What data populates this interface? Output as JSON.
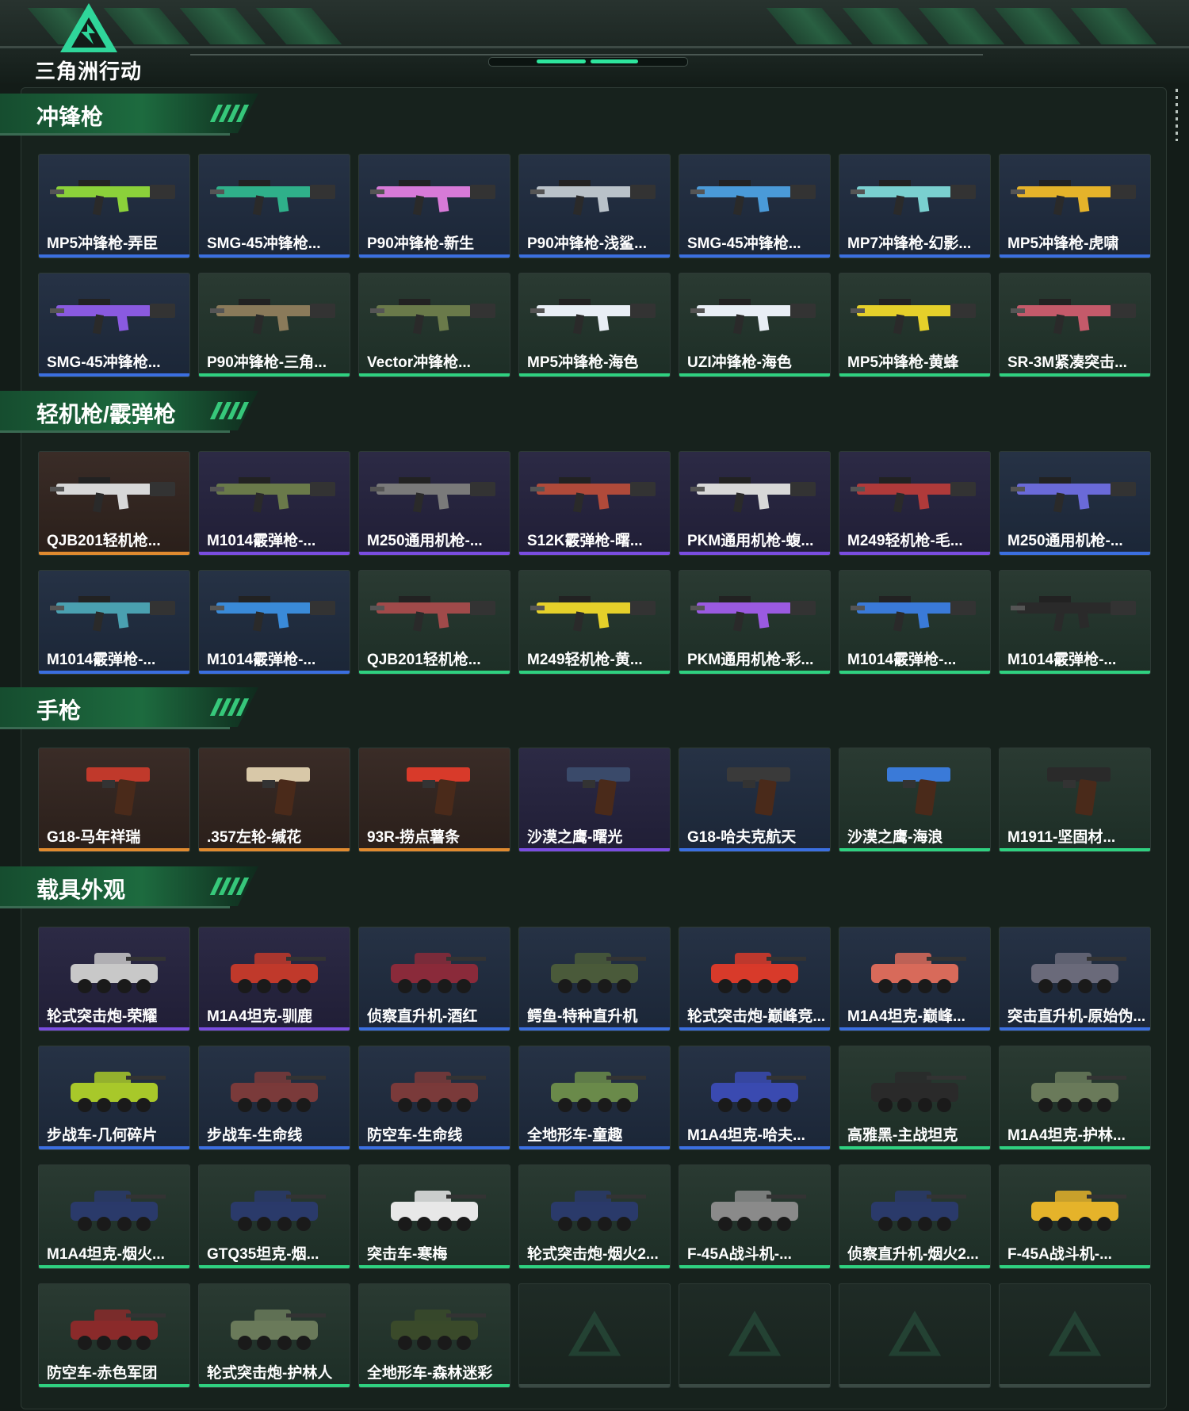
{
  "brand": {
    "name": "三角洲行动"
  },
  "colors": {
    "green": "#2fd180",
    "blue": "#3b6fe0",
    "purple": "#7a4de0",
    "orange": "#e08a2f",
    "empty": "#3a4a44"
  },
  "sections": [
    {
      "title": "冲锋枪",
      "kind": "gun",
      "items": [
        {
          "label": "MP5冲锋枪-弄臣",
          "rarity": "blue",
          "color": "#8bd13a"
        },
        {
          "label": "SMG-45冲锋枪...",
          "rarity": "blue",
          "color": "#2fb08a"
        },
        {
          "label": "P90冲锋枪-新生",
          "rarity": "blue",
          "color": "#d77ad8"
        },
        {
          "label": "P90冲锋枪-浅鲨...",
          "rarity": "blue",
          "color": "#b9c2c9"
        },
        {
          "label": "SMG-45冲锋枪...",
          "rarity": "blue",
          "color": "#4a9ad8"
        },
        {
          "label": "MP7冲锋枪-幻影...",
          "rarity": "blue",
          "color": "#7ad0d0"
        },
        {
          "label": "MP5冲锋枪-虎啸",
          "rarity": "blue",
          "color": "#e5b32a"
        },
        {
          "label": "SMG-45冲锋枪...",
          "rarity": "blue",
          "color": "#8a5ae0"
        },
        {
          "label": "P90冲锋枪-三角...",
          "rarity": "green",
          "color": "#8a7a5a"
        },
        {
          "label": "Vector冲锋枪...",
          "rarity": "green",
          "color": "#6a7a4a"
        },
        {
          "label": "MP5冲锋枪-海色",
          "rarity": "green",
          "color": "#e8eef5"
        },
        {
          "label": "UZI冲锋枪-海色",
          "rarity": "green",
          "color": "#e8eef5"
        },
        {
          "label": "MP5冲锋枪-黄蜂",
          "rarity": "green",
          "color": "#e5d02a"
        },
        {
          "label": "SR-3M紧凑突击...",
          "rarity": "green",
          "color": "#c45a6a"
        }
      ]
    },
    {
      "title": "轻机枪/霰弹枪",
      "kind": "gun",
      "items": [
        {
          "label": "QJB201轻机枪...",
          "rarity": "orange",
          "color": "#d8d8d8"
        },
        {
          "label": "M1014霰弹枪-...",
          "rarity": "purple",
          "color": "#6a7a4a"
        },
        {
          "label": "M250通用机枪-...",
          "rarity": "purple",
          "color": "#7a7a7a"
        },
        {
          "label": "S12K霰弹枪-曙...",
          "rarity": "purple",
          "color": "#b04a3a"
        },
        {
          "label": "PKM通用机枪-蝮...",
          "rarity": "purple",
          "color": "#d8d8d8"
        },
        {
          "label": "M249轻机枪-毛...",
          "rarity": "purple",
          "color": "#b03a3a"
        },
        {
          "label": "M250通用机枪-...",
          "rarity": "blue",
          "color": "#6a6ad8"
        },
        {
          "label": "M1014霰弹枪-...",
          "rarity": "blue",
          "color": "#4aa0b0"
        },
        {
          "label": "M1014霰弹枪-...",
          "rarity": "blue",
          "color": "#3a8ad8"
        },
        {
          "label": "QJB201轻机枪...",
          "rarity": "green",
          "color": "#a04a4a"
        },
        {
          "label": "M249轻机枪-黄...",
          "rarity": "green",
          "color": "#e5d02a"
        },
        {
          "label": "PKM通用机枪-彩...",
          "rarity": "green",
          "color": "#9a5ae0"
        },
        {
          "label": "M1014霰弹枪-...",
          "rarity": "green",
          "color": "#3a7ad8"
        },
        {
          "label": "M1014霰弹枪-...",
          "rarity": "green",
          "color": "#2a2a2a"
        }
      ]
    },
    {
      "title": "手枪",
      "kind": "pistol",
      "items": [
        {
          "label": "G18-马年祥瑞",
          "rarity": "orange",
          "color": "#c0392b"
        },
        {
          "label": ".357左轮-缄花",
          "rarity": "orange",
          "color": "#d8c8a8"
        },
        {
          "label": "93R-捞点薯条",
          "rarity": "orange",
          "color": "#d83a2a"
        },
        {
          "label": "沙漠之鹰-曙光",
          "rarity": "purple",
          "color": "#3a4a6a"
        },
        {
          "label": "G18-哈夫克航天",
          "rarity": "blue",
          "color": "#3a3a3a"
        },
        {
          "label": "沙漠之鹰-海浪",
          "rarity": "green",
          "color": "#3a7ad8"
        },
        {
          "label": "M1911-坚固材...",
          "rarity": "green",
          "color": "#2a2a2a"
        }
      ]
    },
    {
      "title": "载具外观",
      "kind": "vehicle",
      "items": [
        {
          "label": "轮式突击炮-荣耀",
          "rarity": "purple",
          "color": "#c8c8c8"
        },
        {
          "label": "M1A4坦克-驯鹿",
          "rarity": "purple",
          "color": "#c0392b"
        },
        {
          "label": "侦察直升机-酒红",
          "rarity": "blue",
          "color": "#8a2a3a"
        },
        {
          "label": "鳄鱼-特种直升机",
          "rarity": "blue",
          "color": "#4a5a3a"
        },
        {
          "label": "轮式突击炮-巅峰竞...",
          "rarity": "blue",
          "color": "#d83a2a"
        },
        {
          "label": "M1A4坦克-巅峰...",
          "rarity": "blue",
          "color": "#d86a5a"
        },
        {
          "label": "突击直升机-原始伪...",
          "rarity": "blue",
          "color": "#6a6a7a"
        },
        {
          "label": "步战车-几何碎片",
          "rarity": "blue",
          "color": "#a8c82a"
        },
        {
          "label": "步战车-生命线",
          "rarity": "blue",
          "color": "#7a3a3a"
        },
        {
          "label": "防空车-生命线",
          "rarity": "blue",
          "color": "#7a3a3a"
        },
        {
          "label": "全地形车-童趣",
          "rarity": "blue",
          "color": "#6a8a4a"
        },
        {
          "label": "M1A4坦克-哈夫...",
          "rarity": "blue",
          "color": "#3a4ab0"
        },
        {
          "label": "高雅黑-主战坦克",
          "rarity": "green",
          "color": "#2a2a2a"
        },
        {
          "label": "M1A4坦克-护林...",
          "rarity": "green",
          "color": "#6a7a5a"
        },
        {
          "label": "M1A4坦克-烟火...",
          "rarity": "green",
          "color": "#2a3a6a"
        },
        {
          "label": "GTQ35坦克-烟...",
          "rarity": "green",
          "color": "#2a3a6a"
        },
        {
          "label": "突击车-寒梅",
          "rarity": "green",
          "color": "#e8e8e8"
        },
        {
          "label": "轮式突击炮-烟火2...",
          "rarity": "green",
          "color": "#2a3a6a"
        },
        {
          "label": "F-45A战斗机-...",
          "rarity": "green",
          "color": "#8a8a8a"
        },
        {
          "label": "侦察直升机-烟火2...",
          "rarity": "green",
          "color": "#2a3a6a"
        },
        {
          "label": "F-45A战斗机-...",
          "rarity": "green",
          "color": "#e5b32a"
        },
        {
          "label": "防空车-赤色军团",
          "rarity": "green",
          "color": "#8a2a2a"
        },
        {
          "label": "轮式突击炮-护林人",
          "rarity": "green",
          "color": "#6a7a5a"
        },
        {
          "label": "全地形车-森林迷彩",
          "rarity": "green",
          "color": "#3a4a2a"
        },
        {
          "label": "",
          "rarity": "empty",
          "color": ""
        },
        {
          "label": "",
          "rarity": "empty",
          "color": ""
        },
        {
          "label": "",
          "rarity": "empty",
          "color": ""
        },
        {
          "label": "",
          "rarity": "empty",
          "color": ""
        }
      ]
    }
  ]
}
